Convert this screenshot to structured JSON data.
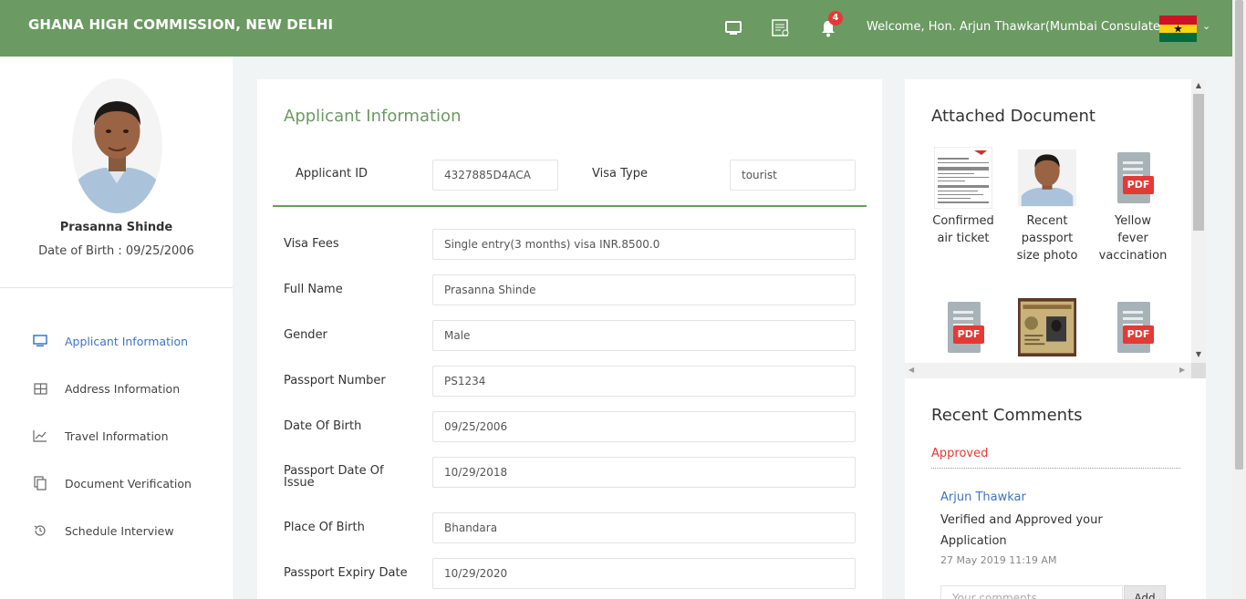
{
  "header": {
    "title": "GHANA HIGH COMMISSION, NEW DELHI",
    "notification_count": "4",
    "welcome": "Welcome, Hon. Arjun Thawkar(Mumbai Consulates)",
    "icons": [
      "monitor-icon",
      "document-list-icon",
      "bell-icon"
    ]
  },
  "profile": {
    "name": "Prasanna Shinde",
    "dob": "Date of Birth : 09/25/2006"
  },
  "sidebar": {
    "items": [
      {
        "label": "Applicant Information",
        "icon": "monitor-icon",
        "active": true
      },
      {
        "label": "Address Information",
        "icon": "grid-icon",
        "active": false
      },
      {
        "label": "Travel Information",
        "icon": "chart-line-icon",
        "active": false
      },
      {
        "label": "Document Verification",
        "icon": "copy-icon",
        "active": false
      },
      {
        "label": "Schedule Interview",
        "icon": "history-icon",
        "active": false
      }
    ]
  },
  "main": {
    "title": "Applicant Information",
    "applicant_id_label": "Applicant ID",
    "applicant_id": "4327885D4ACA",
    "visa_type_label": "Visa Type",
    "visa_type": "tourist",
    "fields": [
      {
        "label": "Visa Fees",
        "value": "Single entry(3 months) visa INR.8500.0"
      },
      {
        "label": "Full Name",
        "value": "Prasanna Shinde"
      },
      {
        "label": "Gender",
        "value": "Male"
      },
      {
        "label": "Passport Number",
        "value": "PS1234"
      },
      {
        "label": "Date Of Birth",
        "value": "09/25/2006"
      },
      {
        "label": "Passport Date Of Issue",
        "value": "10/29/2018"
      },
      {
        "label": "Place Of Birth",
        "value": "Bhandara"
      },
      {
        "label": "Passport Expiry Date",
        "value": "10/29/2020"
      }
    ]
  },
  "documents": {
    "title": "Attached Document",
    "items": [
      {
        "label": "Confirmed air ticket",
        "type": "ticket"
      },
      {
        "label": "Recent passport size photo",
        "type": "photo"
      },
      {
        "label": "Yellow fever vaccination",
        "type": "pdf"
      },
      {
        "label": "",
        "type": "pdf"
      },
      {
        "label": "",
        "type": "id-card"
      },
      {
        "label": "",
        "type": "pdf"
      }
    ],
    "pdf_tag": "PDF"
  },
  "comments": {
    "title": "Recent Comments",
    "status": "Approved",
    "author": "Arjun Thawkar",
    "text": "Verified and Approved your Application",
    "time": "27 May 2019 11:19 AM",
    "placeholder": "Your comments",
    "add_label": "Add"
  },
  "colors": {
    "header": "#6b9a62",
    "accent_blue": "#3f73c6",
    "status_red": "#e53935"
  }
}
